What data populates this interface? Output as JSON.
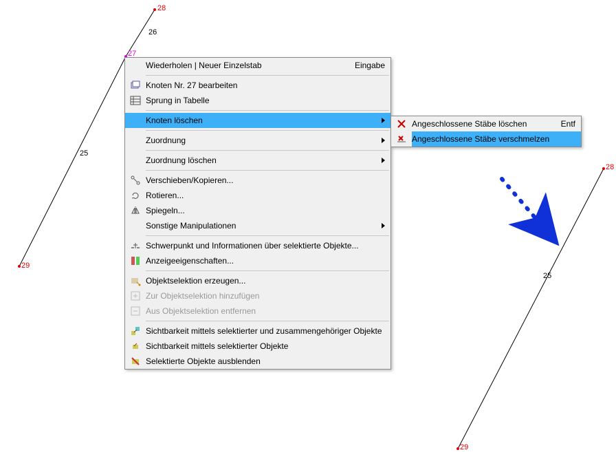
{
  "canvas": {
    "nodes_left": {
      "n28": "28",
      "n27": "27",
      "n29": "29",
      "seg26": "26",
      "seg25": "25"
    },
    "nodes_right": {
      "n28": "28",
      "n29": "29",
      "seg25": "25"
    }
  },
  "menu": {
    "repeat": "Wiederholen | Neuer Einzelstab",
    "repeat_shortcut": "Eingabe",
    "edit_node": "Knoten Nr. 27 bearbeiten",
    "jump_table": "Sprung in Tabelle",
    "delete_node": "Knoten löschen",
    "assignment": "Zuordnung",
    "delete_assignment": "Zuordnung löschen",
    "move_copy": "Verschieben/Kopieren...",
    "rotate": "Rotieren...",
    "mirror": "Spiegeln...",
    "other_manip": "Sonstige Manipulationen",
    "centroid": "Schwerpunkt und Informationen über selektierte Objekte...",
    "display_props": "Anzeigeeigenschaften...",
    "create_sel": "Objektselektion erzeugen...",
    "add_sel": "Zur Objektselektion hinzufügen",
    "remove_sel": "Aus Objektselektion entfernen",
    "vis_related": "Sichtbarkeit mittels selektierter und zusammengehöriger Objekte",
    "vis_selected": "Sichtbarkeit mittels selektierter Objekte",
    "hide_selected": "Selektierte Objekte ausblenden"
  },
  "submenu": {
    "delete_members": "Angeschlossene Stäbe löschen",
    "delete_members_shortcut": "Entf",
    "merge_members": "Angeschlossene Stäbe verschmelzen"
  }
}
